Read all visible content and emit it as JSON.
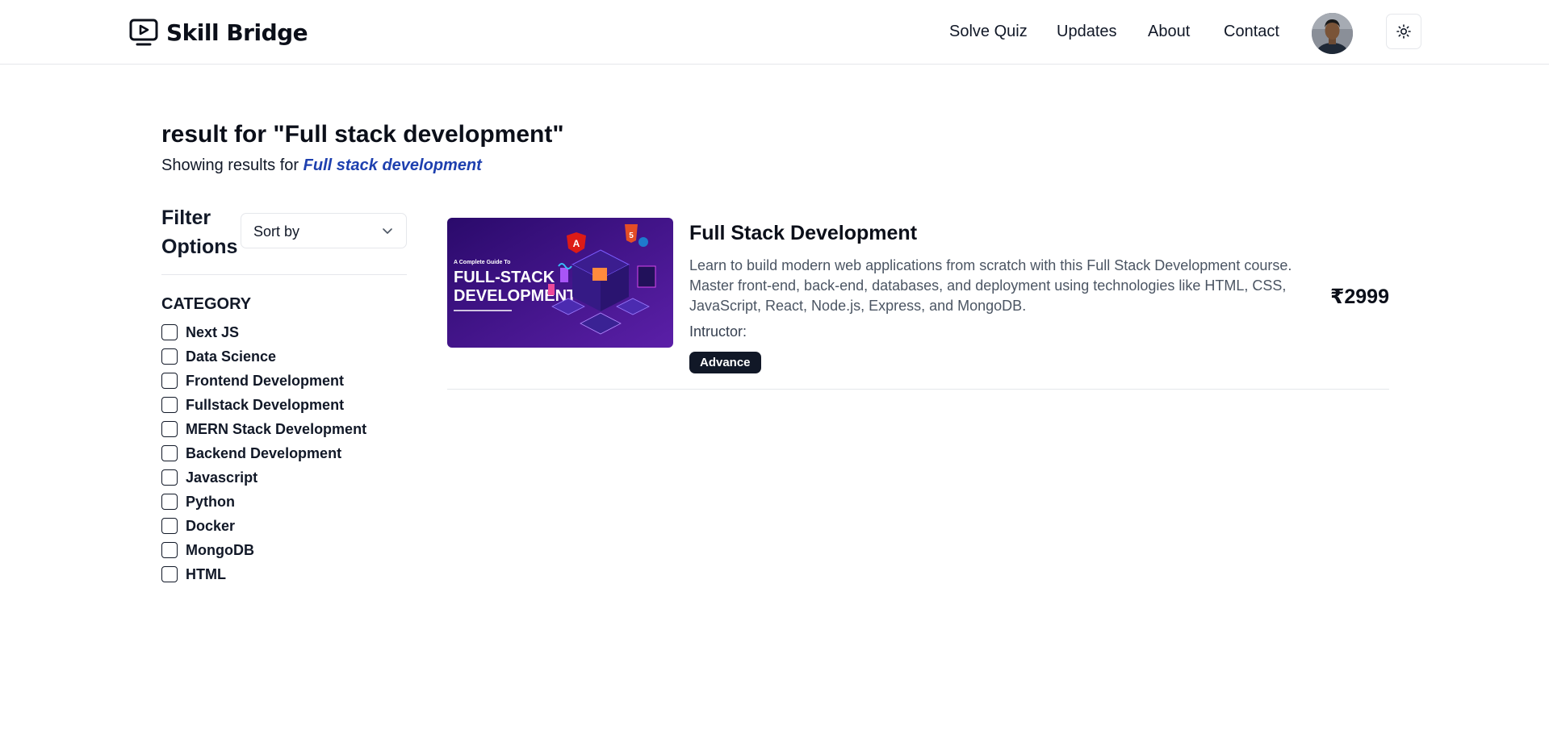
{
  "header": {
    "brand": "Skill Bridge",
    "nav": [
      {
        "label": "Solve Quiz"
      },
      {
        "label": "Updates"
      },
      {
        "label": "About"
      },
      {
        "label": "Contact"
      }
    ]
  },
  "search": {
    "title": "result for \"Full stack development\"",
    "subtitle_prefix": "Showing results for ",
    "query": "Full stack development"
  },
  "filters": {
    "title": "Filter Options",
    "sort_label": "Sort by",
    "category_heading": "CATEGORY",
    "categories": [
      {
        "label": "Next JS",
        "checked": false
      },
      {
        "label": "Data Science",
        "checked": false
      },
      {
        "label": "Frontend Development",
        "checked": false
      },
      {
        "label": "Fullstack Development",
        "checked": false
      },
      {
        "label": "MERN Stack Development",
        "checked": false
      },
      {
        "label": "Backend Development",
        "checked": false
      },
      {
        "label": "Javascript",
        "checked": false
      },
      {
        "label": "Python",
        "checked": false
      },
      {
        "label": "Docker",
        "checked": false
      },
      {
        "label": "MongoDB",
        "checked": false
      },
      {
        "label": "HTML",
        "checked": false
      }
    ]
  },
  "courses": [
    {
      "title": "Full Stack Development",
      "description": "Learn to build modern web applications from scratch with this Full Stack Development course. Master front-end, back-end, databases, and deployment using technologies like HTML, CSS, JavaScript, React, Node.js, Express, and MongoDB.",
      "instructor_label": "Intructor:",
      "level": "Advance",
      "price": "₹2999",
      "thumbnail": {
        "line1": "A Complete Guide To",
        "line2": "FULL-STACK",
        "line3": "DEVELOPMENT",
        "badge_angular": "A",
        "badge_html": "5"
      }
    }
  ],
  "colors": {
    "accent_link": "#1e40af",
    "text_primary": "#0b0f19",
    "muted_text": "#4b5563",
    "border": "#e5e7eb",
    "badge_bg": "#111827",
    "thumb_bg_start": "#2a0a6b",
    "thumb_bg_end": "#5b1fa8"
  },
  "icons": {
    "logo": "play-screen-icon",
    "theme_toggle": "sun-icon",
    "sort": "chevron-down-icon"
  }
}
